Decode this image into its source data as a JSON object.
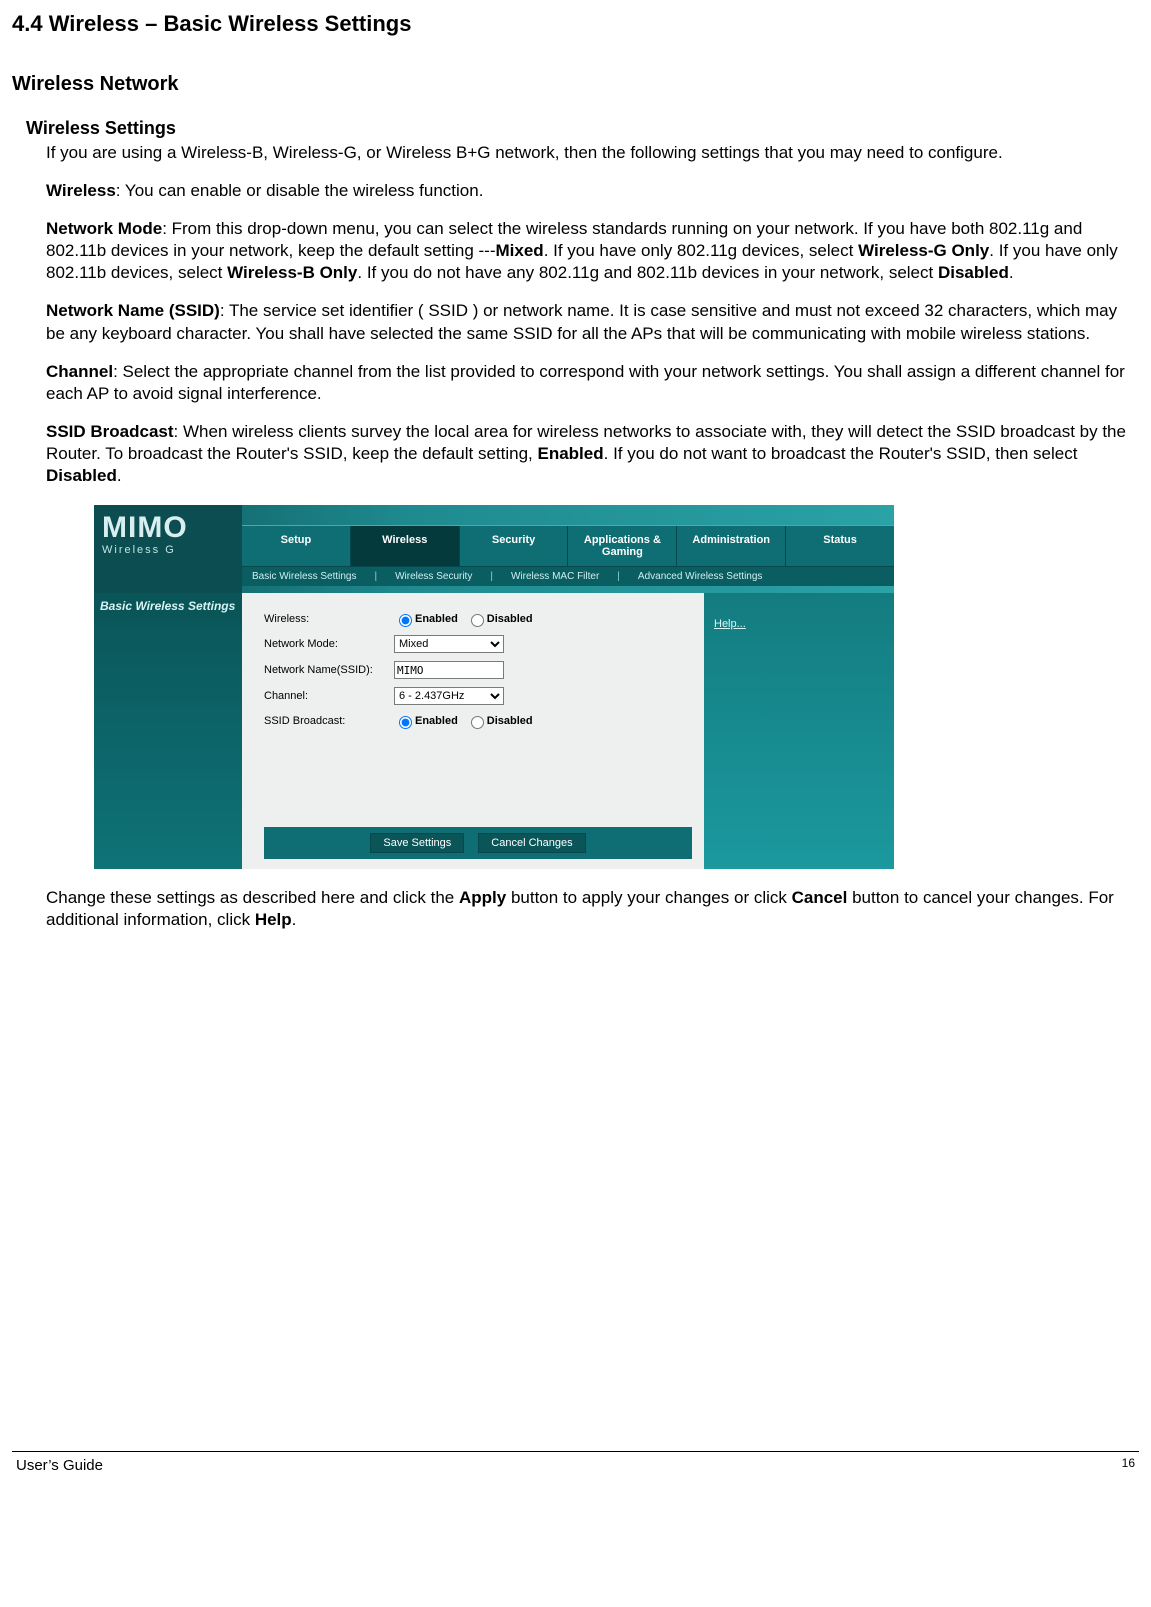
{
  "section_title": "4.4 Wireless – Basic Wireless Settings",
  "h2": "Wireless Network",
  "h3": "Wireless Settings",
  "intro": "If you are using a Wireless-B, Wireless-G, or Wireless B+G network, then the following settings that you may need to configure.",
  "p_wireless_k": "Wireless",
  "p_wireless_v": ": You can enable or disable the wireless function.",
  "p_mode_k": "Network Mode",
  "p_mode_1": ": From this drop-down menu, you can select the wireless standards running on your network. If you have both 802.11g and 802.11b devices in your network, keep the default setting ---",
  "p_mode_b1": "Mixed",
  "p_mode_2": ". If you have only 802.11g devices, select ",
  "p_mode_b2": "Wireless-G Only",
  "p_mode_3": ". If you have only 802.11b devices, select ",
  "p_mode_b3": "Wireless-B Only",
  "p_mode_4": ". If you do not have any 802.11g and 802.11b devices in your network, select ",
  "p_mode_b4": "Disabled",
  "p_mode_5": ".",
  "p_ssid_k": "Network Name (SSID)",
  "p_ssid_v": ": The service set identifier ( SSID ) or network name. It is case sensitive and must not exceed 32 characters, which may be any keyboard character. You shall have selected the same SSID for all the APs that will be communicating with mobile wireless stations.",
  "p_ch_k": "Channel",
  "p_ch_v": ": Select the appropriate channel from the list provided to correspond with your network settings. You shall assign a different channel for each AP to avoid signal interference.",
  "p_bcast_k": "SSID Broadcast",
  "p_bcast_1": ": When wireless clients survey the local area for wireless networks to associate with, they will detect the SSID broadcast by the Router. To broadcast the Router's SSID, keep the default setting, ",
  "p_bcast_b1": "Enabled",
  "p_bcast_2": ". If you do not want to broadcast the Router's SSID, then select ",
  "p_bcast_b2": "Disabled",
  "p_bcast_3": ".",
  "shot": {
    "logo": "MIMO",
    "logo_sub": "Wireless G",
    "tabs": [
      "Setup",
      "Wireless",
      "Security",
      "Applications & Gaming",
      "Administration",
      "Status"
    ],
    "subtabs": [
      "Basic Wireless Settings",
      "Wireless Security",
      "Wireless MAC Filter",
      "Advanced Wireless Settings"
    ],
    "panel_title": "Basic Wireless Settings",
    "help": "Help...",
    "labels": {
      "wireless": "Wireless:",
      "mode": "Network Mode:",
      "ssid": "Network Name(SSID):",
      "channel": "Channel:",
      "bcast": "SSID Broadcast:"
    },
    "radio_enabled": "Enabled",
    "radio_disabled": "Disabled",
    "mode_value": "Mixed",
    "ssid_value": "MIMO",
    "channel_value": "6 - 2.437GHz",
    "btn_save": "Save Settings",
    "btn_cancel": "Cancel Changes"
  },
  "outro_1": "Change these settings as described here and click the ",
  "outro_b1": "Apply",
  "outro_2": " button to apply your changes or click ",
  "outro_b2": "Cancel",
  "outro_3": " button to cancel your changes. For additional information, click ",
  "outro_b3": "Help",
  "outro_4": ".",
  "footer_left": "User’s Guide",
  "footer_right": "16"
}
